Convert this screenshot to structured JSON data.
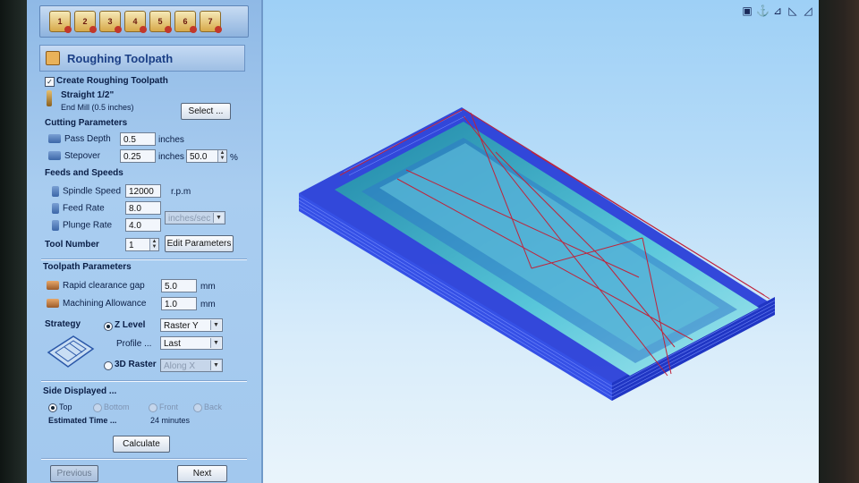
{
  "wizard": {
    "steps": [
      "1",
      "2",
      "3",
      "4",
      "5",
      "6",
      "7"
    ],
    "section_title": "Roughing Toolpath"
  },
  "tool": {
    "create_label": "Create Roughing Toolpath",
    "create_checked": true,
    "tool_name": "Straight 1/2\"",
    "tool_desc": "End Mill (0.5 inches)",
    "select_label": "Select ..."
  },
  "cutting": {
    "header": "Cutting Parameters",
    "pass_depth_label": "Pass Depth",
    "pass_depth_value": "0.5",
    "pass_depth_unit": "inches",
    "stepover_label": "Stepover",
    "stepover_value": "0.25",
    "stepover_unit": "inches",
    "stepover_percent": "50.0",
    "percent_sign": "%"
  },
  "feeds": {
    "header": "Feeds and Speeds",
    "spindle_label": "Spindle Speed",
    "spindle_value": "12000",
    "spindle_unit": "r.p.m",
    "feed_label": "Feed Rate",
    "feed_value": "8.0",
    "plunge_label": "Plunge Rate",
    "plunge_value": "4.0",
    "rate_unit": "inches/sec",
    "tool_number_label": "Tool Number",
    "tool_number_value": "1",
    "edit_params_label": "Edit Parameters"
  },
  "toolpath": {
    "header": "Toolpath Parameters",
    "rapid_label": "Rapid clearance gap",
    "rapid_value": "5.0",
    "rapid_unit": "mm",
    "allowance_label": "Machining Allowance",
    "allowance_value": "1.0",
    "allowance_unit": "mm",
    "strategy_label": "Strategy",
    "z_level_label": "Z Level",
    "z_level_value": "Raster Y",
    "profile_label": "Profile ...",
    "profile_value": "Last",
    "raster3d_label": "3D Raster",
    "raster3d_value": "Along X"
  },
  "side": {
    "header": "Side Displayed ...",
    "options": [
      "Top",
      "Bottom",
      "Front",
      "Back"
    ],
    "selected": "Top",
    "estimated_label": "Estimated Time ...",
    "estimated_value": "24 minutes",
    "calculate_label": "Calculate"
  },
  "nav": {
    "previous_label": "Previous",
    "next_label": "Next"
  },
  "viewport": {
    "tools": [
      "fit-view-icon",
      "anchor-icon",
      "view-iso-icon",
      "view-side-icon",
      "view-front-icon"
    ],
    "toolpath_color": "#2a3fd8",
    "rapid_move_color": "#c0233a"
  }
}
